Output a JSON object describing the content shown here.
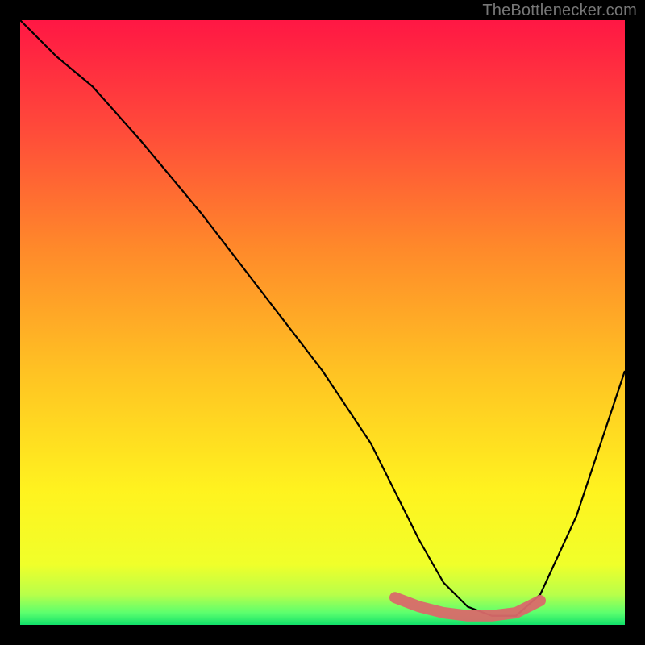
{
  "credit": "TheBottlenecker.com",
  "chart_data": {
    "type": "line",
    "title": "",
    "xlabel": "",
    "ylabel": "",
    "xlim": [
      0,
      100
    ],
    "ylim": [
      0,
      100
    ],
    "series": [
      {
        "name": "bottleneck-curve",
        "color": "#000000",
        "x": [
          0,
          6,
          12,
          20,
          30,
          40,
          50,
          58,
          62,
          66,
          70,
          74,
          78,
          82,
          86,
          92,
          100
        ],
        "y": [
          100,
          94,
          89,
          80,
          68,
          55,
          42,
          30,
          22,
          14,
          7,
          3,
          1.5,
          1.5,
          5,
          18,
          42
        ]
      }
    ],
    "highlight": {
      "name": "bottom-band",
      "color": "#d96a6a",
      "x": [
        62,
        66,
        70,
        74,
        78,
        82,
        86
      ],
      "y": [
        4.5,
        3,
        2,
        1.5,
        1.5,
        2,
        4
      ]
    },
    "background": {
      "type": "vertical-gradient",
      "stops": [
        {
          "offset": 0.0,
          "color": "#ff1744"
        },
        {
          "offset": 0.18,
          "color": "#ff4a3a"
        },
        {
          "offset": 0.38,
          "color": "#ff8a2a"
        },
        {
          "offset": 0.58,
          "color": "#ffc223"
        },
        {
          "offset": 0.78,
          "color": "#fff31f"
        },
        {
          "offset": 0.9,
          "color": "#f0ff2a"
        },
        {
          "offset": 0.95,
          "color": "#b8ff4a"
        },
        {
          "offset": 0.98,
          "color": "#5cff6e"
        },
        {
          "offset": 1.0,
          "color": "#12e06a"
        }
      ]
    }
  }
}
